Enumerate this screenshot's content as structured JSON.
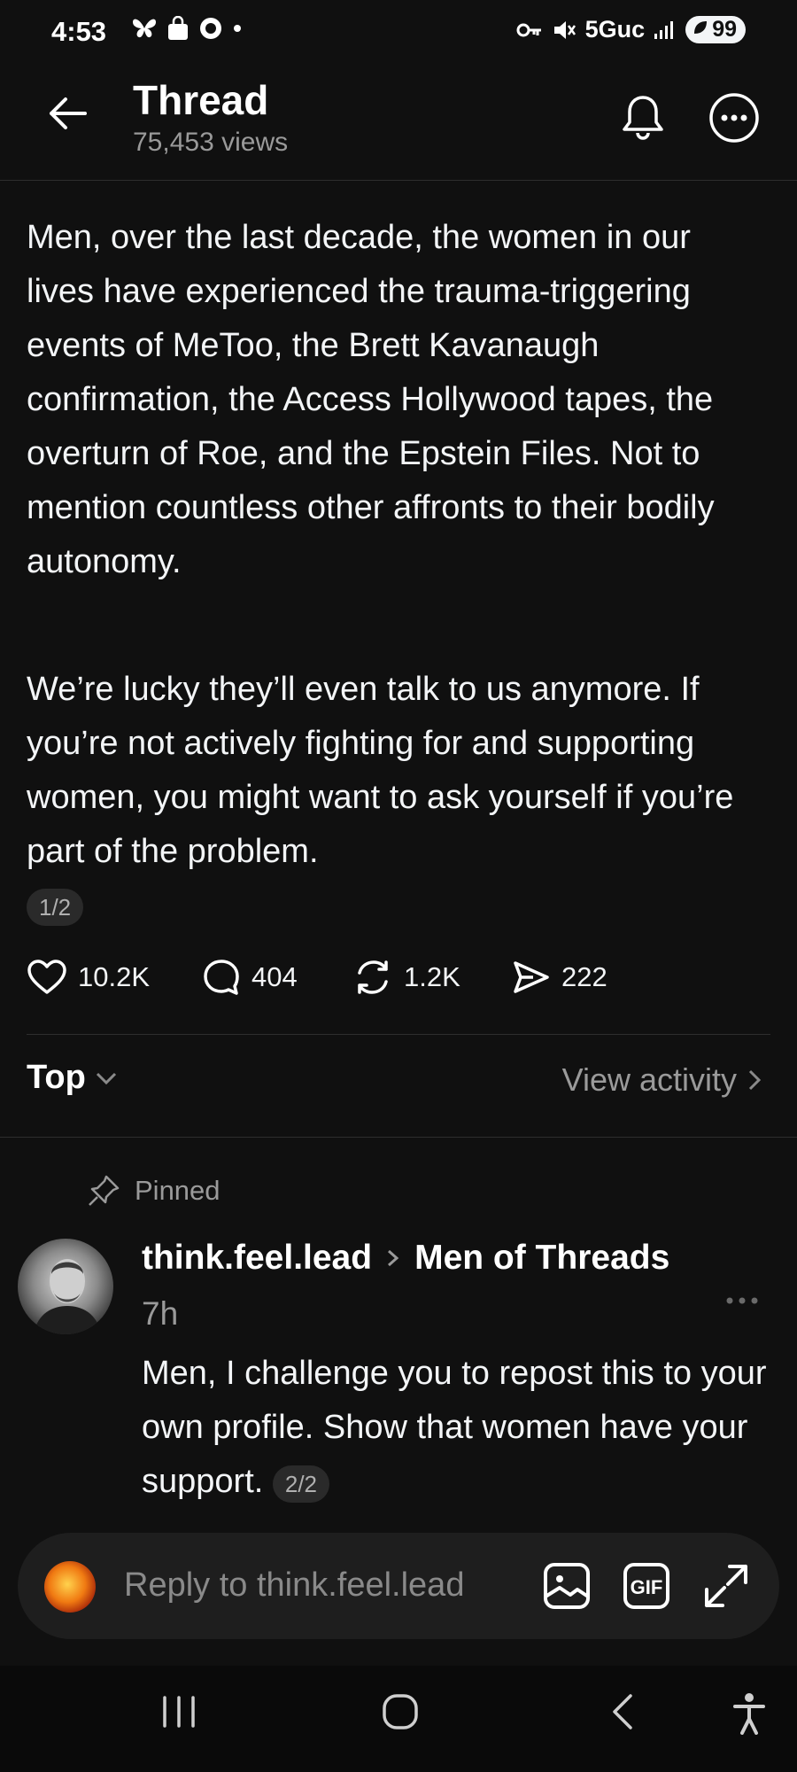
{
  "status_bar": {
    "time": "4:53",
    "network": "5Guc",
    "battery": "99"
  },
  "header": {
    "title": "Thread",
    "views": "75,453 views"
  },
  "post": {
    "paragraph1": "Men, over the last decade, the women in our lives have experienced the trauma-triggering events of MeToo, the Brett Kavanaugh confirmation, the Access Hollywood tapes, the overturn of Roe, and the Epstein Files. Not to mention countless other affronts to their bodily autonomy.",
    "paragraph2": "We’re lucky they’ll even talk to us anymore. If you’re not actively fighting for and supporting women, you might want to ask yourself if you’re part of the problem.",
    "pager": "1/2",
    "likes": "10.2K",
    "comments": "404",
    "reposts": "1.2K",
    "shares": "222"
  },
  "sort": {
    "label": "Top",
    "view_activity": "View activity"
  },
  "reply": {
    "pinned_label": "Pinned",
    "author": "think.feel.lead",
    "community": "Men of Threads",
    "time": "7h",
    "text": "Men, I challenge you to repost this to your own profile. Show that women have your support.",
    "pager": "2/2"
  },
  "composer": {
    "placeholder": "Reply to think.feel.lead",
    "gif_label": "GIF"
  },
  "colors": {
    "background": "#101010",
    "text": "#f3f5f7",
    "secondary": "#9a9a9a"
  }
}
